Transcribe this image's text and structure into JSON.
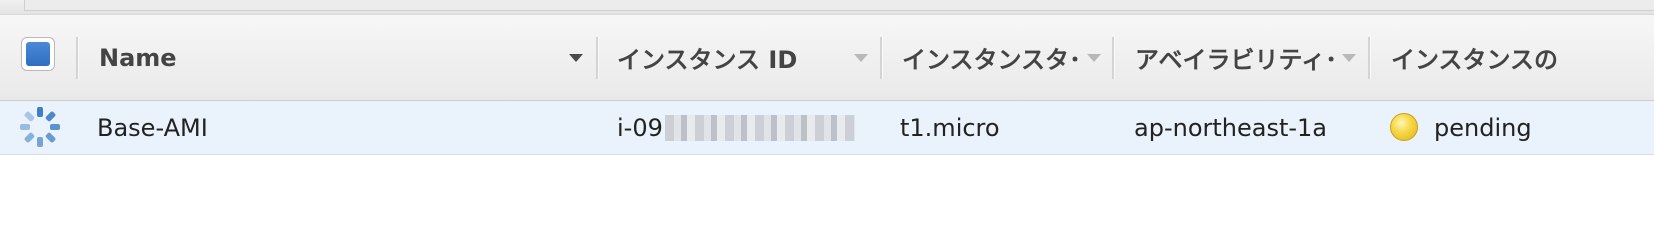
{
  "table": {
    "columns": [
      {
        "label": "Name"
      },
      {
        "label": "インスタンス ID"
      },
      {
        "label": "インスタンスタ･"
      },
      {
        "label": "アベイラビリティ･"
      },
      {
        "label": "インスタンスの"
      }
    ],
    "rows": [
      {
        "name": "Base-AMI",
        "instance_id": "i-09",
        "instance_type": "t1.micro",
        "availability_zone": "ap-northeast-1a",
        "state": "pending"
      }
    ]
  },
  "colors": {
    "checkbox_fill": "#2f6dc0",
    "row_selected_bg": "#eaf2fc",
    "status_pending": "#f7d84a"
  },
  "icons": {
    "row_state": "loading-spinner-icon",
    "status": "pending-status-icon"
  }
}
